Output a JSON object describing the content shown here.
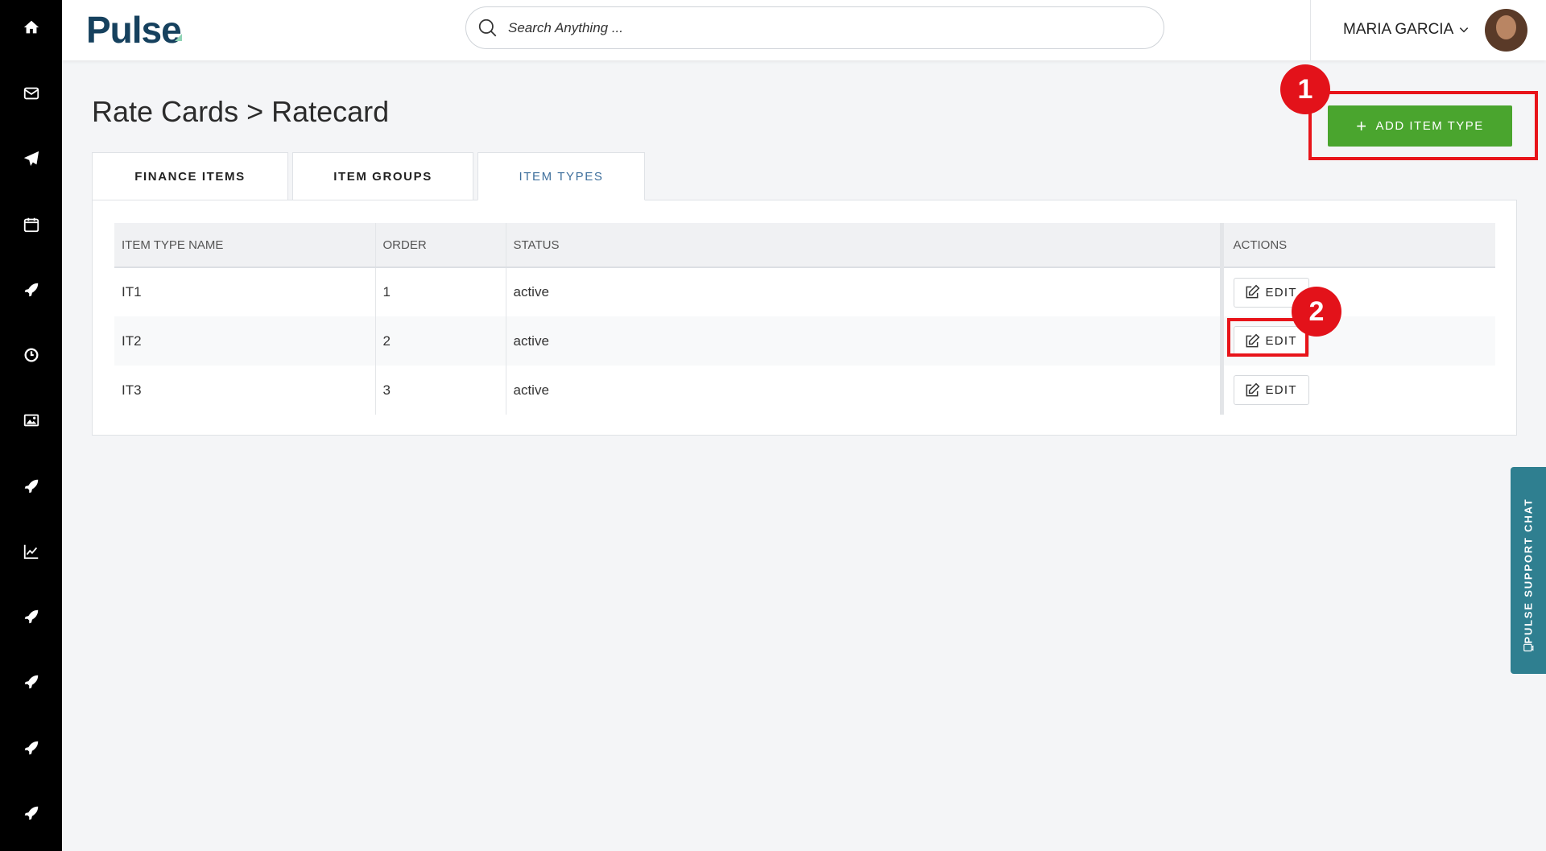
{
  "sidebar": {
    "items": [
      {
        "icon": "home-icon",
        "label": "Home"
      },
      {
        "icon": "mail-icon",
        "label": "Mail"
      },
      {
        "icon": "send-icon",
        "label": "Send"
      },
      {
        "icon": "calendar-icon",
        "label": "Calendar"
      },
      {
        "icon": "rocket-icon",
        "label": "Launch"
      },
      {
        "icon": "clock-icon",
        "label": "Time"
      },
      {
        "icon": "image-icon",
        "label": "Images"
      },
      {
        "icon": "rocket-icon",
        "label": "Launch"
      },
      {
        "icon": "chart-icon",
        "label": "Analytics"
      },
      {
        "icon": "rocket-icon",
        "label": "Launch"
      },
      {
        "icon": "rocket-icon",
        "label": "Launch"
      },
      {
        "icon": "rocket-icon",
        "label": "Launch"
      },
      {
        "icon": "rocket-icon",
        "label": "Launch"
      }
    ]
  },
  "header": {
    "logo": "Pulse",
    "search_placeholder": "Search Anything ...",
    "user_name": "MARIA GARCIA"
  },
  "page": {
    "title": "Rate Cards > Ratecard",
    "add_button_label": "ADD ITEM TYPE"
  },
  "tabs": [
    {
      "label": "FINANCE ITEMS",
      "active": false
    },
    {
      "label": "ITEM GROUPS",
      "active": false
    },
    {
      "label": "ITEM TYPES",
      "active": true
    }
  ],
  "table": {
    "columns": [
      "ITEM TYPE NAME",
      "ORDER",
      "STATUS",
      "ACTIONS"
    ],
    "rows": [
      {
        "name": "IT1",
        "order": "1",
        "status": "active",
        "action": "EDIT"
      },
      {
        "name": "IT2",
        "order": "2",
        "status": "active",
        "action": "EDIT"
      },
      {
        "name": "IT3",
        "order": "3",
        "status": "active",
        "action": "EDIT"
      }
    ]
  },
  "annotations": [
    {
      "number": "1",
      "target": "add-item-type-button"
    },
    {
      "number": "2",
      "target": "edit-button-row-2"
    }
  ],
  "support_chat": {
    "label": "PULSE SUPPORT CHAT"
  },
  "colors": {
    "sidebar_bg": "#000000",
    "brand_navy": "#16415e",
    "add_button_green": "#4aa52e",
    "active_tab_blue": "#3e6f9c",
    "annotation_red": "#e3121a",
    "support_chat_teal": "#2f7f90"
  }
}
